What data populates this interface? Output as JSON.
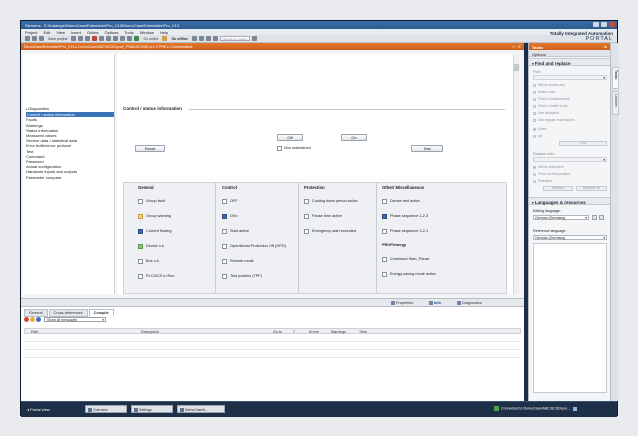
{
  "app": {
    "title": "Siemens - E:\\Kataloge\\DemoCase\\Entwickler\\Pro_V13\\DemoCase\\Entwickler\\Pro_V13",
    "brand_line1": "Totally Integrated Automation",
    "brand_line2": "PORTAL"
  },
  "menu": [
    "Project",
    "Edit",
    "View",
    "Insert",
    "Online",
    "Options",
    "Tools",
    "Window",
    "Help"
  ],
  "toolbar": {
    "save_project": "Save project",
    "go_online": "Go online",
    "go_offline": "Go offline",
    "search_placeholder": "<Search in project>"
  },
  "path": "DemoCase\\Entwickler\\Pro_V13 ▸ DemoCase\\ABC\\SCDD\\pnet_PNBDACODE pro V PRE ▸ Control/status",
  "tree": [
    {
      "label": "Diagnostics",
      "selected": false,
      "root": true
    },
    {
      "label": "Control / status information",
      "selected": true
    },
    {
      "label": "Faults",
      "selected": false
    },
    {
      "label": "Warnings",
      "selected": false
    },
    {
      "label": "Status information",
      "selected": false
    },
    {
      "label": "Measured values",
      "selected": false
    },
    {
      "label": "Service data / statistical data",
      "selected": false
    },
    {
      "label": "Error buffer/error protocol",
      "selected": false
    },
    {
      "label": "Test",
      "selected": false
    },
    {
      "label": "Command",
      "selected": false
    },
    {
      "label": "Password",
      "selected": false
    },
    {
      "label": "Actual configuration",
      "selected": false
    },
    {
      "label": "Hardware inputs and outputs",
      "selected": false
    },
    {
      "label": "Parameter compare",
      "selected": false
    }
  ],
  "control": {
    "section_title": "Control / status information",
    "off_label": "Off",
    "on_label": "On",
    "reset_label": "Reset",
    "test_label": "Test",
    "non_maintained_label": "Non maintained"
  },
  "columns": {
    "general": {
      "title": "General",
      "items": [
        {
          "label": "Group fault",
          "state": "off"
        },
        {
          "label": "Group warning",
          "state": "yellow"
        },
        {
          "label": "Current flowing",
          "state": "on"
        },
        {
          "label": "Device o.k.",
          "state": "green"
        },
        {
          "label": "Bus o.k.",
          "state": "off"
        },
        {
          "label": "PLC/DCS in Run",
          "state": "off"
        }
      ]
    },
    "control": {
      "title": "Control",
      "items": [
        {
          "label": "OFF",
          "state": "off"
        },
        {
          "label": "ON>",
          "state": "on"
        },
        {
          "label": "Start active",
          "state": "off"
        },
        {
          "label": "Operational Protection Off (OPO)",
          "state": "off"
        },
        {
          "label": "Remote mode",
          "state": "off"
        },
        {
          "label": "Test position (TPF)",
          "state": "off"
        }
      ]
    },
    "protection": {
      "title": "Protection",
      "items": [
        {
          "label": "Cooling down period active",
          "state": "off"
        },
        {
          "label": "Pause time active",
          "state": "off"
        },
        {
          "label": "Emergency start executed",
          "state": "off"
        }
      ]
    },
    "other": {
      "title": "Other/ Miscellaneous",
      "items": [
        {
          "label": "Device test active",
          "state": "off"
        },
        {
          "label": "Phase sequence 1-2-3",
          "state": "on"
        },
        {
          "label": "Phase sequence 3-2-1",
          "state": "off"
        }
      ],
      "profi_label": "PROFIenergy",
      "profi_items": [
        {
          "label": "Command Start_Pause",
          "state": "off"
        },
        {
          "label": "Energy-saving mode active",
          "state": "off"
        }
      ]
    }
  },
  "bottom_tabs": {
    "properties": "Properties",
    "info": "Info",
    "diagnostics": "Diagnostics"
  },
  "inspector": {
    "tabs": [
      "General",
      "Cross-references",
      "Compile"
    ],
    "active_tab": "Compile",
    "filter": "Show all messages",
    "headers": [
      "Path",
      "Description",
      "Go to",
      "?",
      "Errors",
      "Warnings",
      "Time"
    ]
  },
  "task": {
    "header": "Tasks",
    "options_label": "Options",
    "find_header": "Find and replace",
    "find_label": "Find:",
    "options": [
      "Whole words only",
      "Match case",
      "Find in substructures",
      "Find in hidden texts",
      "Use wildcards",
      "Use regular expressions"
    ],
    "direction": [
      "Down",
      "Up"
    ],
    "find_button": "Find",
    "replace_label": "Replace with:",
    "scope": [
      "Whole document",
      "From current position",
      "Selection"
    ],
    "replace_button": "Replace",
    "replace_all_button": "Replace all",
    "lang_header": "Languages & resources",
    "editing_lang_label": "Editing language:",
    "editing_lang": "German (Germany)",
    "reference_lang_label": "Reference language:",
    "reference_lang": "German (Germany)"
  },
  "side_tabs": [
    "Tasks",
    "Libraries"
  ],
  "taskbar": {
    "portal_view": "Portal view",
    "items": [
      "Overview",
      "Settings",
      "DemoCaseN..."
    ],
    "status": "Connected to DemoCase\\ABC\\SCDD\\pro..."
  },
  "colors": {
    "accent_orange": "#e4772c",
    "selection_blue": "#3b73b9",
    "taskbar_navy": "#1e2f48"
  }
}
